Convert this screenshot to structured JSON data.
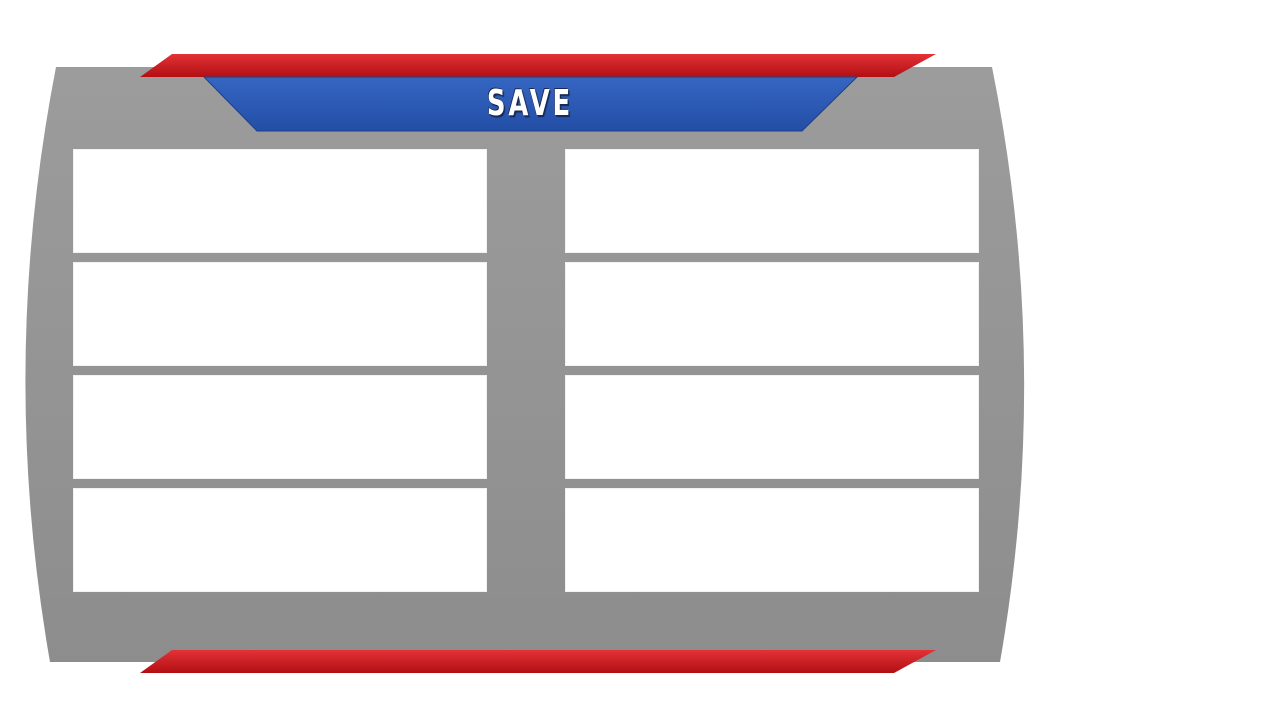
{
  "header": {
    "title": "SAVE"
  },
  "colors": {
    "panel_top": "#9a9a9a",
    "panel_bottom": "#8e8e8e",
    "accent_red": "#d8262a",
    "accent_red_dark": "#b51014",
    "title_blue": "#2f5fb8",
    "title_blue_dark": "#2450a8",
    "slot_background": "#ffffff"
  },
  "save_slots": {
    "left": [
      {
        "label": ""
      },
      {
        "label": ""
      },
      {
        "label": ""
      },
      {
        "label": ""
      }
    ],
    "right": [
      {
        "label": ""
      },
      {
        "label": ""
      },
      {
        "label": ""
      },
      {
        "label": ""
      }
    ]
  }
}
